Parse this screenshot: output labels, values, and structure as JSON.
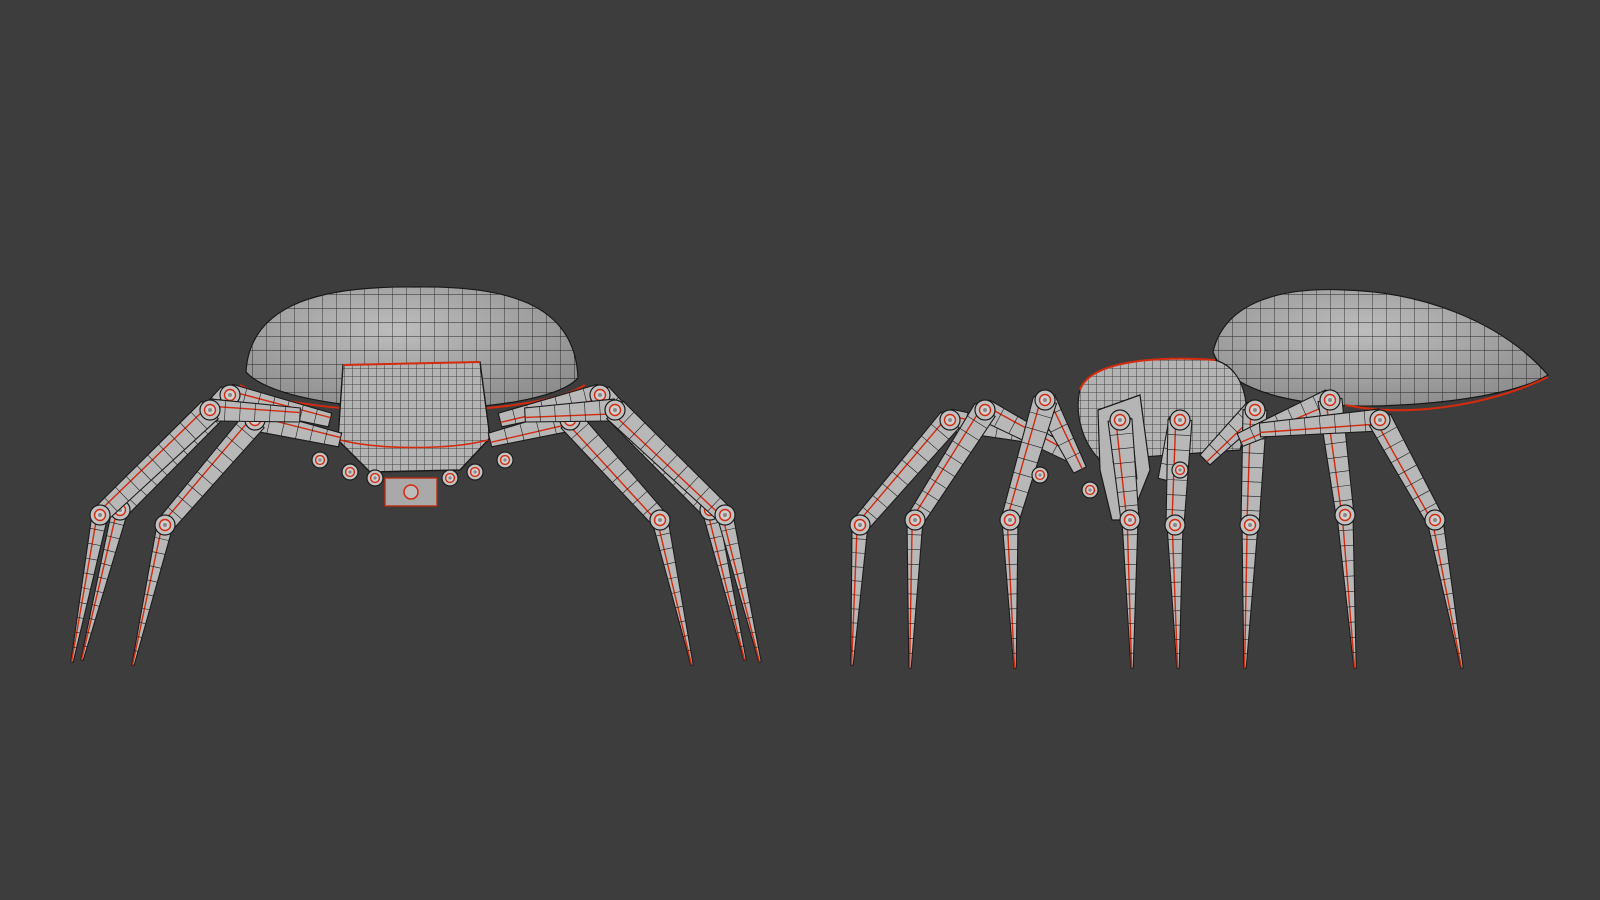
{
  "viewport": {
    "background": "#3d3d3d",
    "mesh_fill": "#b9b9b9",
    "mesh_shadow": "#8e8e8e",
    "wire_color": "#1c1c1c",
    "seam_color": "#d42a0e"
  },
  "models": [
    {
      "view": "front",
      "icon": "spider-robot-front-icon"
    },
    {
      "view": "side",
      "icon": "spider-robot-side-icon"
    }
  ]
}
